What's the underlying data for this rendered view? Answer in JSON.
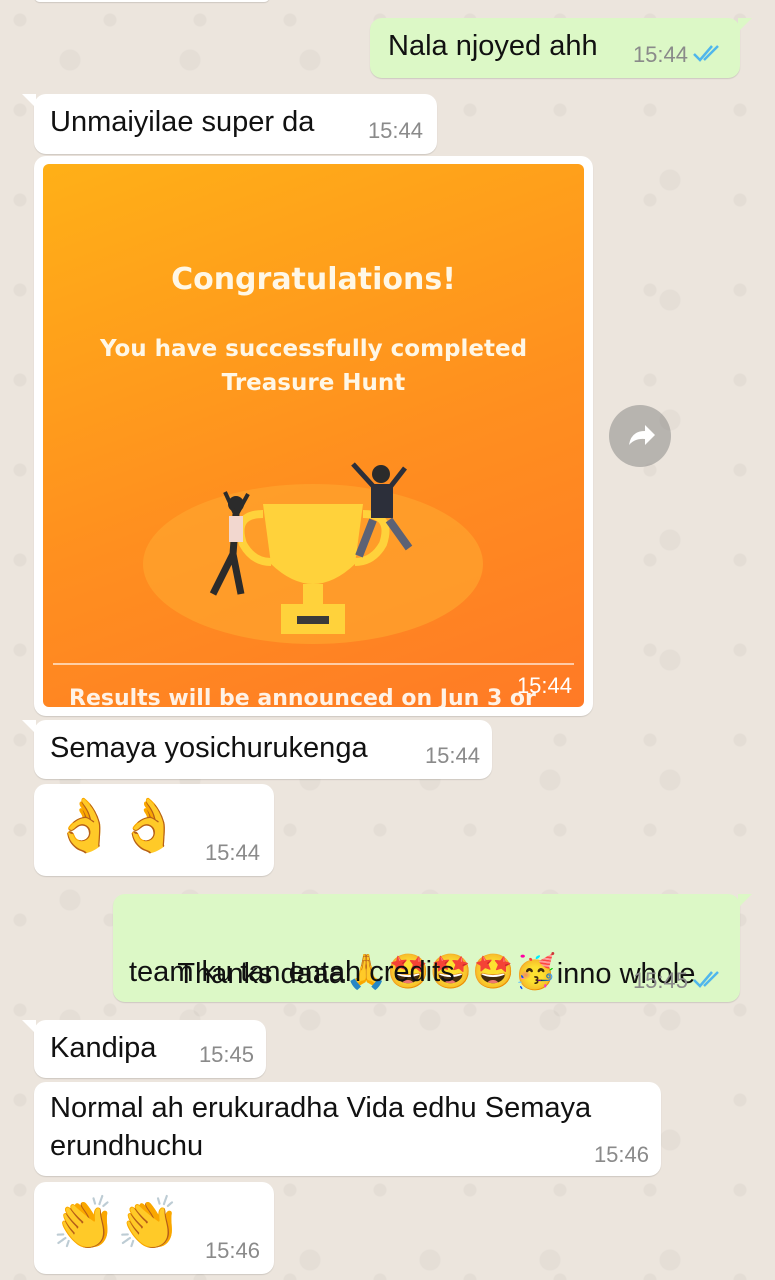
{
  "messages": [
    {
      "text": "Nala njoyed ahh",
      "time": "15:44"
    },
    {
      "text": "Unmaiyilae super da",
      "time": "15:44"
    },
    {
      "image": {
        "title": "Congratulations!",
        "subtitle_line1": "You have successfully completed",
        "subtitle_line2": "Treasure Hunt",
        "footer": "Results will be announced on Jun 3 or",
        "time": "15:44"
      }
    },
    {
      "text": "Semaya yosichurukenga",
      "time": "15:44"
    },
    {
      "emoji": "👌👌",
      "time": "15:44"
    },
    {
      "text_a": "Thanks daaa",
      "emoji": "🙏🤩🤩🤩🥳",
      "text_b": "inno whole",
      "text_c": "team ku tan entah credits",
      "time": "15:45"
    },
    {
      "text": "Kandipa",
      "time": "15:45"
    },
    {
      "text_line1": "Normal ah erukuradha Vida edhu Semaya",
      "text_line2": "erundhuchu",
      "time": "15:46"
    },
    {
      "emoji": "👏👏",
      "time": "15:46"
    }
  ],
  "icons": {
    "read_receipt": "double-check-icon",
    "forward": "forward-arrow-icon"
  },
  "colors": {
    "incoming_bubble": "#ffffff",
    "outgoing_bubble": "#dcf8c6",
    "read_tick": "#4fb6ec",
    "wallpaper": "#ece5dd"
  }
}
